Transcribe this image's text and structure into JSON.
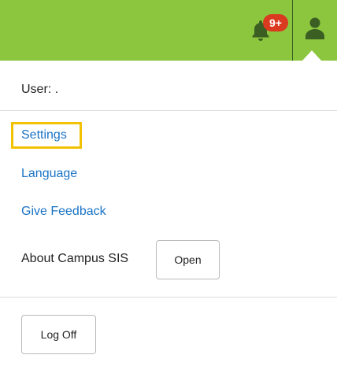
{
  "topbar": {
    "notification_badge": "9+",
    "accent_color": "#8cc63f",
    "badge_color": "#d93a20",
    "notification_icon": "bell-icon",
    "user_icon": "user-icon"
  },
  "menu": {
    "user_label": "User:",
    "user_value": ".",
    "links": {
      "settings": "Settings",
      "language": "Language",
      "feedback": "Give Feedback"
    },
    "highlight_color": "#f2c100",
    "link_color": "#1a73c6",
    "about_label": "About Campus SIS",
    "open_button": "Open",
    "logoff_button": "Log Off"
  }
}
